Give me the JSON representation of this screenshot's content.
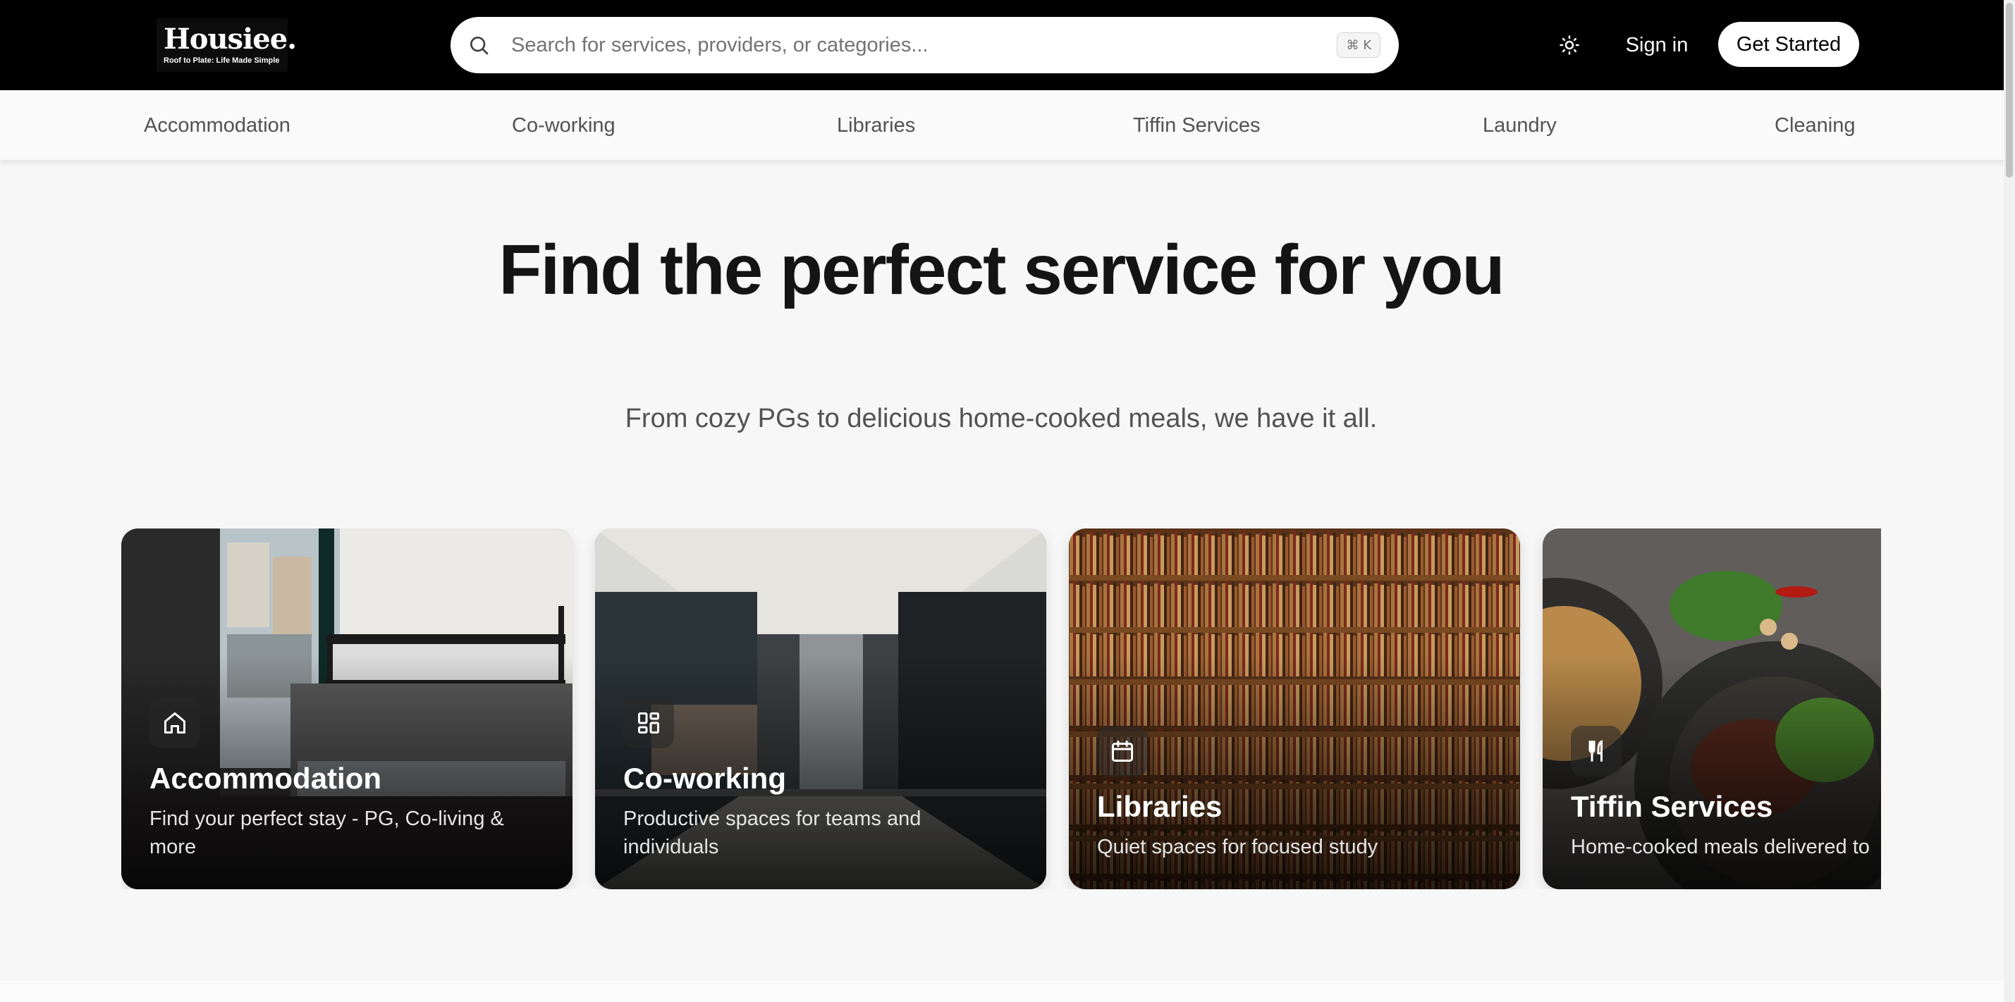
{
  "header": {
    "logo_name": "Housiee.",
    "logo_tagline": "Roof to Plate: Life Made Simple",
    "search_placeholder": "Search for services, providers, or categories...",
    "search_value": "",
    "search_shortcut": "⌘ K",
    "signin_label": "Sign in",
    "cta_label": "Get Started",
    "icons": {
      "search": "search-icon",
      "theme": "sun-icon"
    }
  },
  "nav": {
    "items": [
      "Accommodation",
      "Co-working",
      "Libraries",
      "Tiffin Services",
      "Laundry",
      "Cleaning"
    ]
  },
  "hero": {
    "title": "Find the perfect service for you",
    "subtitle": "From cozy PGs to delicious home-cooked meals, we have it all."
  },
  "cards": [
    {
      "title": "Accommodation",
      "description": "Find your perfect stay - PG, Co-living & more",
      "icon": "home-icon"
    },
    {
      "title": "Co-working",
      "description": "Productive spaces for teams and individuals",
      "icon": "grid-icon"
    },
    {
      "title": "Libraries",
      "description": "Quiet spaces for focused study",
      "icon": "calendar-icon"
    },
    {
      "title": "Tiffin Services",
      "description": "Home-cooked meals delivered to",
      "icon": "utensils-icon"
    }
  ],
  "colors": {
    "header_bg": "#000000",
    "page_bg": "#f7f7f7",
    "text_primary": "#171717",
    "text_muted": "#525252"
  }
}
